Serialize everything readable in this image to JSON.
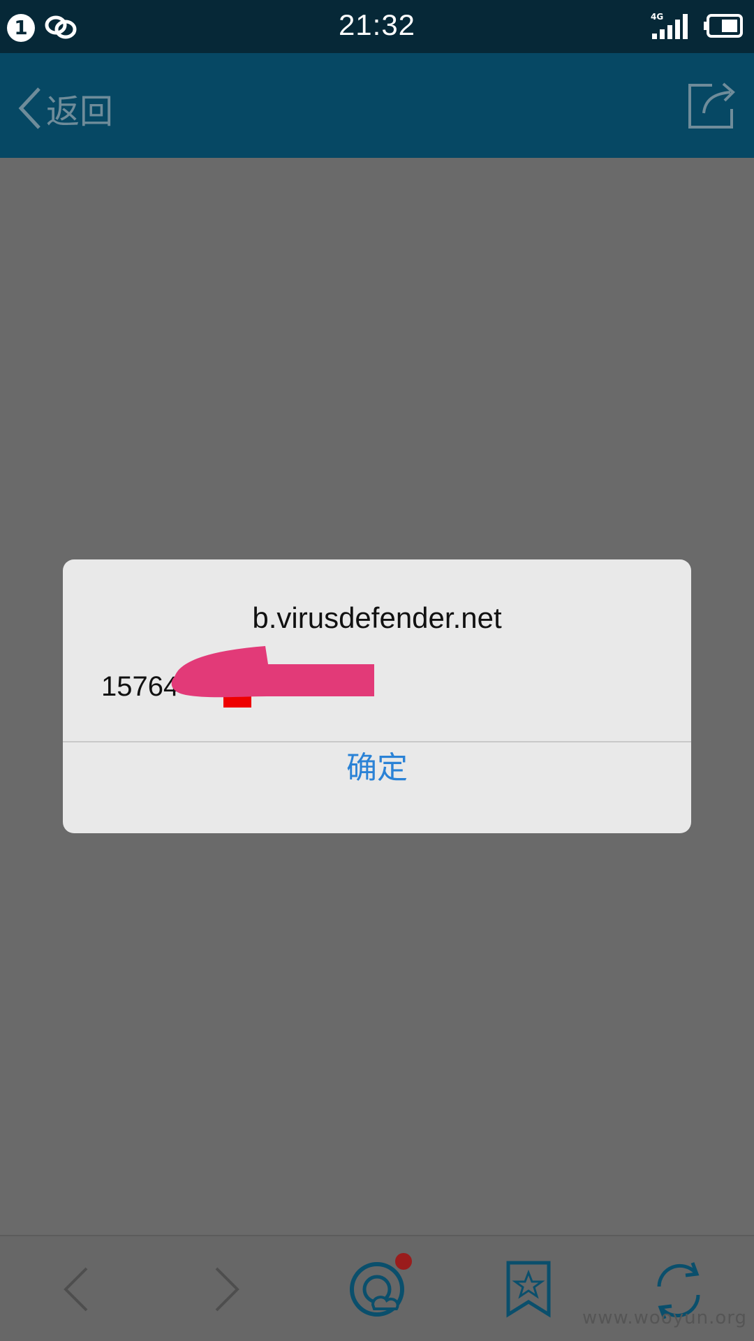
{
  "status_bar": {
    "notification_count": "1",
    "time": "21:32",
    "network_label": "4G",
    "icons": [
      "notification-badge",
      "link-icon",
      "signal-icon",
      "battery-icon"
    ]
  },
  "nav_bar": {
    "back_label": "返回",
    "icons": [
      "chevron-left-icon",
      "share-icon"
    ]
  },
  "dialog": {
    "title": "b.virusdefender.net",
    "message_visible": "15764",
    "message_redacted": true,
    "confirm_label": "确定",
    "colors": {
      "confirm_text": "#2a82d6",
      "redaction": "#e23a78"
    }
  },
  "toolbar": {
    "items": [
      "back-icon",
      "forward-icon",
      "browser-home-icon",
      "bookmark-star-icon",
      "refresh-icon"
    ],
    "has_notification_dot": true
  },
  "watermark": "www.wooyun.org",
  "colors": {
    "status_bar": "#062837",
    "nav_bar": "#064864",
    "overlay": "#6a6a6a"
  }
}
